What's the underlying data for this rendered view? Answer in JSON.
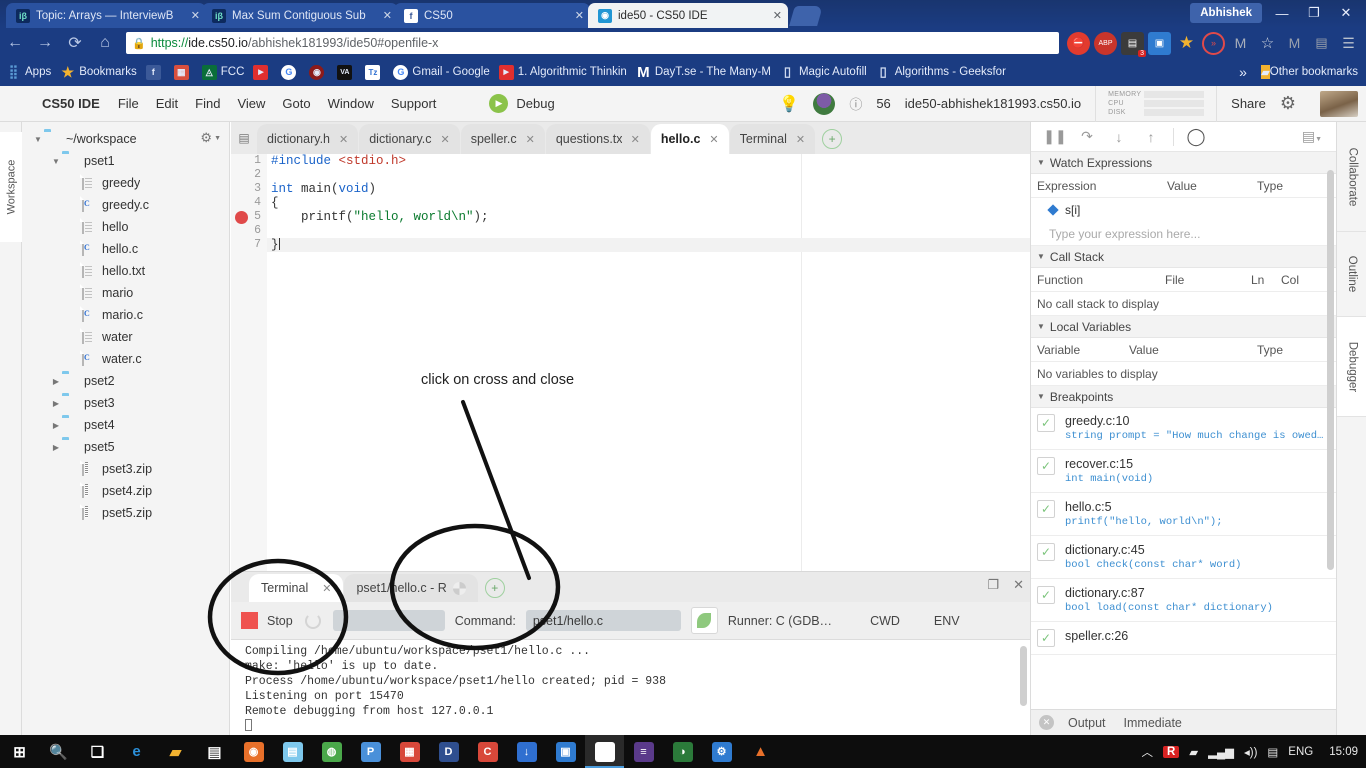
{
  "browser": {
    "tabs": [
      {
        "title": "Topic: Arrays — InterviewB",
        "favicon_label": "iβ",
        "active": false,
        "close": "✕"
      },
      {
        "title": "Max Sum Contiguous Sub",
        "favicon_label": "iβ",
        "active": false,
        "close": "✕"
      },
      {
        "title": "CS50",
        "favicon_label": "f",
        "active": false,
        "close": "✕"
      },
      {
        "title": "ide50 - CS50 IDE",
        "favicon_label": "◉",
        "active": true,
        "close": "✕"
      }
    ],
    "profile_name": "Abhishek",
    "window_buttons": {
      "minimize": "—",
      "maximize": "❐",
      "close": "✕"
    },
    "nav": {
      "back": "←",
      "forward": "→",
      "reload": "⟳",
      "home": "⌂"
    },
    "address": {
      "lock_icon": "lock-icon",
      "scheme": "https://",
      "host": "ide.cs50.io",
      "path": "/abhishek181993/ide50#openfile-x",
      "full_url": "https://ide.cs50.io/abhishek181993/ide50#openfile-x"
    },
    "extensions": [
      {
        "name": "ublock-icon",
        "glyph": "⛔",
        "color": "#e23b2e"
      },
      {
        "name": "adblockplus-icon",
        "glyph": "ABP",
        "color": "#c9352b"
      },
      {
        "name": "downloads-icon",
        "glyph": "▤",
        "color": "#3b3b3b",
        "badge": "3"
      },
      {
        "name": "window-icon",
        "glyph": "▣",
        "color": "#2f7bd0"
      },
      {
        "name": "star-extension-icon",
        "glyph": "★",
        "color": "#f2b230"
      },
      {
        "name": "forward-ext-icon",
        "glyph": "»",
        "color": "#e04a4a"
      },
      {
        "name": "bookmark-manager-icon",
        "glyph": "M",
        "color": "#a9afbb"
      },
      {
        "name": "star-bookmark-icon",
        "glyph": "☆",
        "color": "#d6dae2"
      },
      {
        "name": "m-extension-icon",
        "glyph": "M",
        "color": "#9aa1ad"
      },
      {
        "name": "reader-icon",
        "glyph": "▤",
        "color": "#9aa1ad"
      },
      {
        "name": "chrome-menu-icon",
        "glyph": "☰",
        "color": "#b9c1cd"
      }
    ],
    "bookmarks": [
      {
        "label": "Apps",
        "icon": "apps-grid-icon",
        "color": "#4a90d9"
      },
      {
        "label": "Bookmarks",
        "icon": "star-icon",
        "color": "#f2b230"
      },
      {
        "label": "",
        "icon": "facebook-icon",
        "color": "#3b5998",
        "glyph": "f"
      },
      {
        "label": "",
        "icon": "chrome-store-icon",
        "color": "#d84f3e",
        "glyph": "▦"
      },
      {
        "label": "FCC",
        "icon": "freecodecamp-icon",
        "color": "#0a6e3a",
        "glyph": "◬"
      },
      {
        "label": "",
        "icon": "youtube-icon",
        "color": "#e02f2f",
        "glyph": "▶"
      },
      {
        "label": "",
        "icon": "google-icon",
        "color": "#ffffff",
        "glyph": "G"
      },
      {
        "label": "",
        "icon": "deadpool-icon",
        "color": "#8c1a1a",
        "glyph": "◉"
      },
      {
        "label": "",
        "icon": "va-icon",
        "color": "#111111",
        "glyph": "VA"
      },
      {
        "label": "",
        "icon": "tz-icon",
        "color": "#2f6fd0",
        "glyph": "Tz"
      },
      {
        "label": "Gmail - Google",
        "icon": "google-icon",
        "color": "#ffffff",
        "glyph": "G"
      },
      {
        "label": "1. Algorithmic Thinkin",
        "icon": "youtube-icon",
        "color": "#e02f2f",
        "glyph": "▶"
      },
      {
        "label": "DayT.se - The Many-M",
        "icon": "m-icon",
        "color": "#111111",
        "glyph": "M"
      },
      {
        "label": "Magic Autofill",
        "icon": "page-icon",
        "color": "#dfe6f5",
        "glyph": "▯"
      },
      {
        "label": "Algorithms - Geeksfor",
        "icon": "page-icon",
        "color": "#dfe6f5",
        "glyph": "▯"
      }
    ],
    "bookmarks_overflow": "»",
    "other_bookmarks": {
      "label": "Other bookmarks",
      "icon": "folder-icon"
    }
  },
  "ide": {
    "menubar": {
      "brand": "CS50 IDE",
      "items": [
        "File",
        "Edit",
        "Find",
        "View",
        "Goto",
        "Window",
        "Support"
      ],
      "debug_label": "Debug",
      "lightbulb_icon": "lightbulb-icon",
      "avatar_icon": "user-avatar-icon",
      "info_icon": "info-icon",
      "counter": "56",
      "hostname": "ide50-abhishek181993.cs50.io",
      "meters": [
        {
          "label": "MEMORY",
          "fill_pct": 8
        },
        {
          "label": "CPU",
          "fill_pct": 0
        },
        {
          "label": "DISK",
          "fill_pct": 28
        }
      ],
      "share_label": "Share",
      "gear_icon": "gear-icon",
      "cat_icon": "cat-photo-icon"
    },
    "left_rail": {
      "tab_label": "Workspace"
    },
    "right_rail": {
      "tabs": [
        {
          "label": "Collaborate",
          "active": false
        },
        {
          "label": "Outline",
          "active": false
        },
        {
          "label": "Debugger",
          "active": true
        }
      ]
    },
    "filetree": {
      "gear_icon": "gear-icon",
      "caret_icon": "chevron-down-icon",
      "nodes": [
        {
          "label": "~/workspace",
          "type": "folder",
          "depth": 0,
          "open": true
        },
        {
          "label": "pset1",
          "type": "folder",
          "depth": 1,
          "open": true
        },
        {
          "label": "greedy",
          "type": "file",
          "depth": 2
        },
        {
          "label": "greedy.c",
          "type": "cfile",
          "depth": 2
        },
        {
          "label": "hello",
          "type": "file",
          "depth": 2
        },
        {
          "label": "hello.c",
          "type": "cfile",
          "depth": 2
        },
        {
          "label": "hello.txt",
          "type": "file",
          "depth": 2
        },
        {
          "label": "mario",
          "type": "file",
          "depth": 2
        },
        {
          "label": "mario.c",
          "type": "cfile",
          "depth": 2
        },
        {
          "label": "water",
          "type": "file",
          "depth": 2
        },
        {
          "label": "water.c",
          "type": "cfile",
          "depth": 2
        },
        {
          "label": "pset2",
          "type": "folder",
          "depth": 1,
          "open": false
        },
        {
          "label": "pset3",
          "type": "folder",
          "depth": 1,
          "open": false
        },
        {
          "label": "pset4",
          "type": "folder",
          "depth": 1,
          "open": false
        },
        {
          "label": "pset5",
          "type": "folder",
          "depth": 1,
          "open": false
        },
        {
          "label": "pset3.zip",
          "type": "zip",
          "depth": 2
        },
        {
          "label": "pset4.zip",
          "type": "zip",
          "depth": 2
        },
        {
          "label": "pset5.zip",
          "type": "zip",
          "depth": 2
        }
      ]
    },
    "editor": {
      "pane_icon": "pane-list-icon",
      "tabs": [
        {
          "label": "dictionary.h",
          "active": false,
          "close": "✕"
        },
        {
          "label": "dictionary.c",
          "active": false,
          "close": "✕"
        },
        {
          "label": "speller.c",
          "active": false,
          "close": "✕"
        },
        {
          "label": "questions.txt",
          "active": false,
          "close": "✕"
        },
        {
          "label": "hello.c",
          "active": true,
          "close": "✕"
        },
        {
          "label": "Terminal",
          "active": false,
          "close": "✕"
        }
      ],
      "add_tab": "+",
      "lines": [
        {
          "n": "1",
          "segments": [
            {
              "t": "#include ",
              "c": "pre"
            },
            {
              "t": "<stdio.h>",
              "c": "inc"
            }
          ]
        },
        {
          "n": "2",
          "segments": []
        },
        {
          "n": "3",
          "segments": [
            {
              "t": "int ",
              "c": "kw"
            },
            {
              "t": "main(",
              "c": ""
            },
            {
              "t": "void",
              "c": "kw"
            },
            {
              "t": ")",
              "c": ""
            }
          ]
        },
        {
          "n": "4",
          "segments": [
            {
              "t": "{",
              "c": ""
            }
          ]
        },
        {
          "n": "5",
          "breakpoint": true,
          "segments": [
            {
              "t": "    printf(",
              "c": ""
            },
            {
              "t": "\"hello, world\\n\"",
              "c": "str"
            },
            {
              "t": ");",
              "c": ""
            }
          ]
        },
        {
          "n": "6",
          "segments": []
        },
        {
          "n": "7",
          "cursor": true,
          "segments": [
            {
              "t": "}",
              "c": ""
            }
          ]
        }
      ]
    },
    "debugger": {
      "toolbar": [
        {
          "name": "pause-icon",
          "glyph": "❚❚"
        },
        {
          "name": "step-over-icon",
          "glyph": "↷"
        },
        {
          "name": "step-into-icon",
          "glyph": "↓"
        },
        {
          "name": "step-out-icon",
          "glyph": "↑"
        },
        {
          "name": "breakpoint-toggle-icon",
          "glyph": "◯"
        },
        {
          "name": "debugger-menu-icon",
          "glyph": "▤"
        }
      ],
      "watch": {
        "section": "Watch Expressions",
        "columns": [
          "Expression",
          "Value",
          "Type"
        ],
        "rows": [
          {
            "expression": "s[i]",
            "value": "",
            "type": ""
          }
        ],
        "placeholder": "Type your expression here..."
      },
      "call_stack": {
        "section": "Call Stack",
        "columns": [
          "Function",
          "File",
          "Ln",
          "Col"
        ],
        "empty": "No call stack to display"
      },
      "locals": {
        "section": "Local Variables",
        "columns": [
          "Variable",
          "Value",
          "Type"
        ],
        "empty": "No variables to display"
      },
      "breakpoints": {
        "section": "Breakpoints",
        "items": [
          {
            "location": "greedy.c:10",
            "code": "string prompt = \"How much change is owed…",
            "checked": true
          },
          {
            "location": "recover.c:15",
            "code": "int main(void)",
            "checked": true
          },
          {
            "location": "hello.c:5",
            "code": "printf(\"hello, world\\n\");",
            "checked": true
          },
          {
            "location": "dictionary.c:45",
            "code": "bool check(const char* word)",
            "checked": true
          },
          {
            "location": "dictionary.c:87",
            "code": "bool load(const char* dictionary)",
            "checked": true
          },
          {
            "location": "speller.c:26",
            "code": "",
            "checked": true
          }
        ]
      },
      "output_bar": {
        "close_icon": "close-circle-icon",
        "tabs": [
          "Output",
          "Immediate"
        ]
      }
    },
    "console": {
      "tabs": [
        {
          "label": "Terminal",
          "active": true,
          "close": "✕"
        },
        {
          "label": "pset1/hello.c - R",
          "active": false,
          "spinner": true
        }
      ],
      "add_tab": "+",
      "restore_icon": "restore-icon",
      "close_icon": "close-icon",
      "runbar": {
        "stop_label": "Stop",
        "command_label": "Command:",
        "command_value": "pset1/hello.c",
        "runner_label": "Runner: C (GDB…",
        "cwd_label": "CWD",
        "env_label": "ENV",
        "runner_icon": "leaf-icon"
      },
      "output_lines": [
        "Compiling /home/ubuntu/workspace/pset1/hello.c ...",
        "make: 'hello' is up to date.",
        "Process /home/ubuntu/workspace/pset1/hello created; pid = 938",
        "Listening on port 15470",
        "Remote debugging from host 127.0.0.1"
      ]
    }
  },
  "annotations": {
    "note_text": "click on cross and close",
    "shapes": [
      "arrow-line",
      "ellipse-around-stop-button",
      "ellipse-around-runner-tab"
    ]
  },
  "taskbar": {
    "items": [
      {
        "name": "start-button-icon",
        "glyph": "⊞",
        "color": "#ffffff",
        "bg": "transparent"
      },
      {
        "name": "search-icon",
        "glyph": "🔍",
        "color": "#ffffff",
        "bg": "transparent"
      },
      {
        "name": "task-view-icon",
        "glyph": "❑",
        "color": "#ffffff",
        "bg": "transparent"
      },
      {
        "name": "edge-icon",
        "glyph": "e",
        "color": "#2b8fd8",
        "bg": "transparent"
      },
      {
        "name": "file-explorer-icon",
        "glyph": "▰",
        "color": "#f2b230",
        "bg": "transparent"
      },
      {
        "name": "store-icon",
        "glyph": "▤",
        "color": "#ffffff",
        "bg": "transparent"
      },
      {
        "name": "firefox-icon",
        "glyph": "◉",
        "color": "#e8702a",
        "bg": "#e8702a"
      },
      {
        "name": "folder-app-icon",
        "glyph": "▤",
        "color": "#7ec8ec",
        "bg": "#7ec8ec"
      },
      {
        "name": "globe-app-icon",
        "glyph": "◍",
        "color": "#4aa84a",
        "bg": "#4aa84a"
      },
      {
        "name": "p-app-icon",
        "glyph": "P",
        "color": "#4a90d9",
        "bg": "#4a90d9"
      },
      {
        "name": "office-icon",
        "glyph": "▦",
        "color": "#d8483a",
        "bg": "#d8483a"
      },
      {
        "name": "devcpp-icon",
        "glyph": "D",
        "color": "#2f4f8f",
        "bg": "#2f4f8f"
      },
      {
        "name": "ccleaner-icon",
        "glyph": "C",
        "color": "#d8483a",
        "bg": "#d8483a"
      },
      {
        "name": "download-manager-icon",
        "glyph": "↓",
        "color": "#2f6fd0",
        "bg": "#2f6fd0"
      },
      {
        "name": "teamviewer-icon",
        "glyph": "▣",
        "color": "#2f7bd0",
        "bg": "#2f7bd0"
      },
      {
        "name": "chrome-icon",
        "glyph": "◉",
        "color": "#e8702a",
        "bg": "#ffffff",
        "active": true
      },
      {
        "name": "utorrent-icon",
        "glyph": "≡",
        "color": "#5a3a8a",
        "bg": "#5a3a8a"
      },
      {
        "name": "vuescan-icon",
        "glyph": "◑",
        "color": "#2b7a3a",
        "bg": "#2b7a3a"
      },
      {
        "name": "settings-app-icon",
        "glyph": "⚙",
        "color": "#2f7bd0",
        "bg": "#2f7bd0"
      },
      {
        "name": "vlc-icon",
        "glyph": "▲",
        "color": "#e8702a",
        "bg": "transparent"
      }
    ],
    "tray": [
      {
        "name": "show-hidden-icons",
        "glyph": "︿"
      },
      {
        "name": "antivirus-icon",
        "glyph": "R",
        "color": "#d82222"
      },
      {
        "name": "battery-icon",
        "glyph": "▮"
      },
      {
        "name": "network-icon",
        "glyph": "▂▄▆"
      },
      {
        "name": "volume-icon",
        "glyph": "🔊"
      },
      {
        "name": "action-center-icon",
        "glyph": "▤"
      }
    ],
    "language": "ENG",
    "clock": "15:09"
  }
}
